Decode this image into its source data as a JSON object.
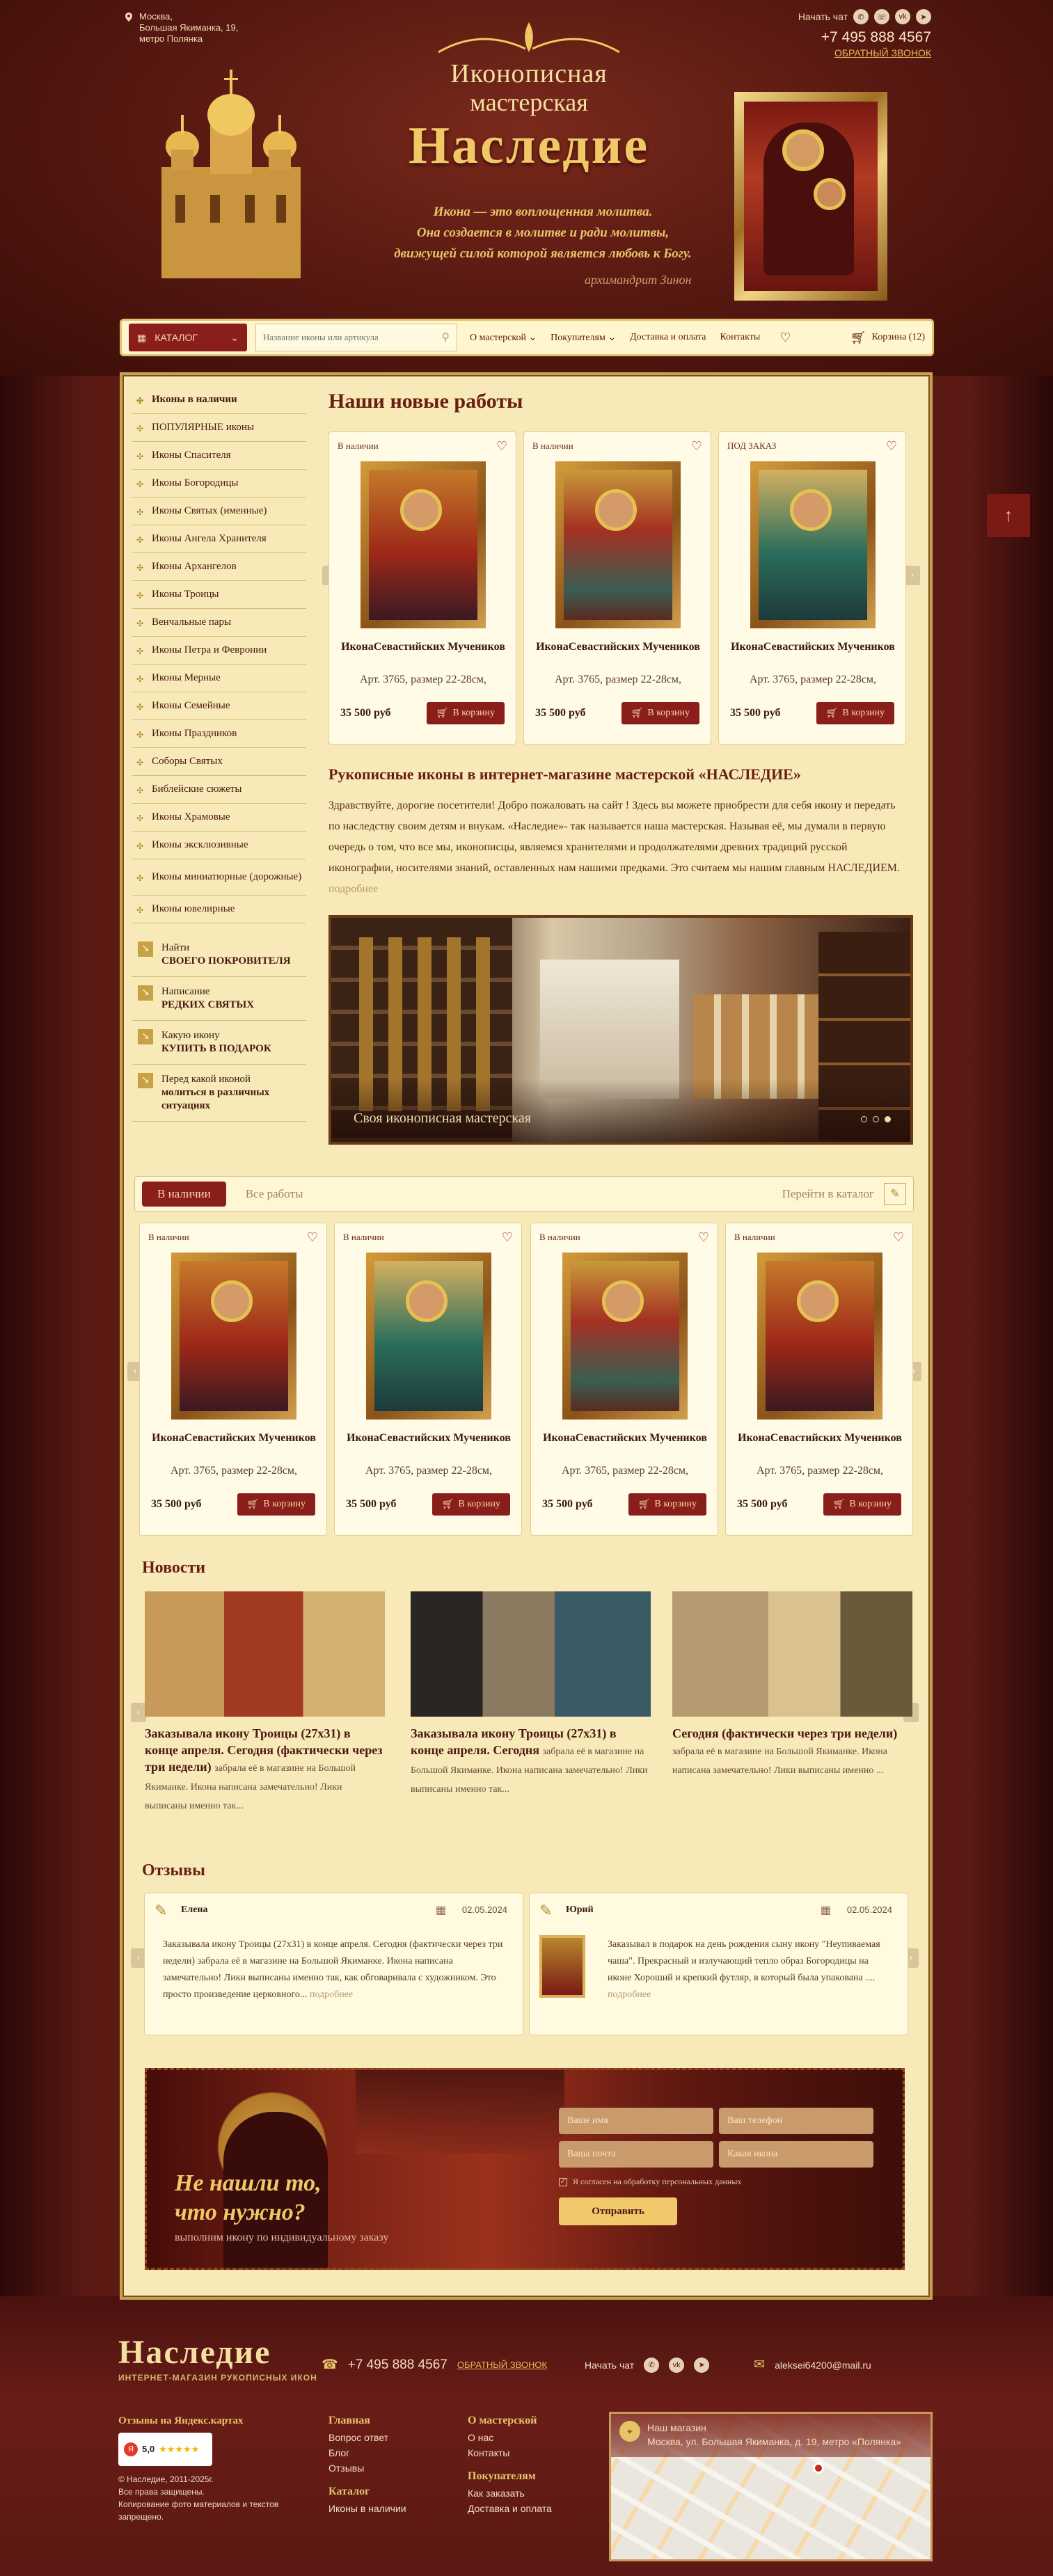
{
  "header": {
    "address_lines": [
      "Москва,",
      "Большая Якиманка, 19,",
      "метро Полянка"
    ],
    "logo_line1": "Иконописная",
    "logo_line2": "мастерская",
    "logo_line3": "Наследие",
    "quote_lines": [
      "Икона — это воплощенная молитва.",
      "Она создается в молитве и ради молитвы,",
      "движущей силой которой является любовь к Богу."
    ],
    "signature": "архимандрит Зинон",
    "chat_label": "Начать чат",
    "phone": "+7 495 888 4567",
    "callback": "ОБРАТНЫЙ ЗВОНОК"
  },
  "nav": {
    "catalog": "КАТАЛОГ",
    "search_placeholder": "Название иконы или артикула",
    "links": [
      "О мастерской",
      "Покупателям",
      "Доставка и оплата",
      "Контакты"
    ],
    "cart": "Корзина (12)"
  },
  "sidebar": {
    "items": [
      "Иконы в наличии",
      "ПОПУЛЯРНЫЕ иконы",
      "Иконы Спасителя",
      "Иконы Богородицы",
      "Иконы Святых (именные)",
      "Иконы Ангела Хранителя",
      "Иконы Архангелов",
      "Иконы Троицы",
      "Венчальные пары",
      "Иконы Петра и Февронии",
      "Иконы Мерные",
      "Иконы Семейные",
      "Иконы Праздников",
      "Соборы Святых",
      "Библейские сюжеты",
      "Иконы Храмовые",
      "Иконы эксклюзивные",
      "Иконы миниатюрные (дорожные)",
      "Иконы ювелирные"
    ],
    "extras": [
      {
        "top": "Найти",
        "bottom": "СВОЕГО ПОКРОВИТЕЛЯ"
      },
      {
        "top": "Написание",
        "bottom": "РЕДКИХ СВЯТЫХ"
      },
      {
        "top": "Какую икону",
        "bottom": "КУПИТЬ В ПОДАРОК"
      },
      {
        "top": "Перед какой иконой",
        "bottom": "молиться в различных ситуациях"
      }
    ]
  },
  "new_works": {
    "heading": "Наши новые работы",
    "cards": [
      {
        "status": "В наличии",
        "title": "ИконаСевастийских Мучеников",
        "art": "Арт. 3765, размер 22-28см,",
        "price": "35 500 руб",
        "buy": "В корзину"
      },
      {
        "status": "В наличии",
        "title": "ИконаСевастийских Мучеников",
        "art": "Арт. 3765, размер 22-28см,",
        "price": "35 500 руб",
        "buy": "В корзину"
      },
      {
        "status": "ПОД ЗАКАЗ",
        "title": "ИконаСевастийских Мучеников",
        "art": "Арт. 3765, размер 22-28см,",
        "price": "35 500 руб",
        "buy": "В корзину"
      }
    ]
  },
  "intro": {
    "heading": "Рукописные иконы в интернет-магазине мастерской «НАСЛЕДИЕ»",
    "text": "Здравствуйте, дорогие посетители! Добро пожаловать на сайт ! Здесь вы можете приобрести для себя икону и передать по наследству своим детям и внукам. «Наследие»- так называется наша мастерская. Называя её, мы думали в первую очередь о том, что все мы, иконописцы, являемся хранителями и продолжателями древних традиций русской иконографии, носителями знаний, оставленных нам нашими предками. Это считаем мы нашим главным НАСЛЕДИЕМ.",
    "more": "подробнее"
  },
  "banner": {
    "caption": "Своя иконописная мастерская"
  },
  "tabs": {
    "active": "В наличии",
    "inactive": "Все работы",
    "catalog_link": "Перейти в каталог"
  },
  "stock_cards": [
    {
      "status": "В наличии",
      "title": "ИконаСевастийских Мучеников",
      "art": "Арт. 3765, размер 22-28см,",
      "price": "35 500 руб",
      "buy": "В корзину"
    },
    {
      "status": "В наличии",
      "title": "ИконаСевастийских Мучеников",
      "art": "Арт. 3765, размер 22-28см,",
      "price": "35 500 руб",
      "buy": "В корзину"
    },
    {
      "status": "В наличии",
      "title": "ИконаСевастийских Мучеников",
      "art": "Арт. 3765, размер 22-28см,",
      "price": "35 500 руб",
      "buy": "В корзину"
    },
    {
      "status": "В наличии",
      "title": "ИконаСевастийских Мучеников",
      "art": "Арт. 3765, размер 22-28см,",
      "price": "35 500 руб",
      "buy": "В корзину"
    }
  ],
  "news": {
    "heading": "Новости",
    "items": [
      {
        "title": "Заказывала икону Троицы (27х31) в конце апреля. Сегодня (фактически через три недели)",
        "text": "забрала её в магазине на Большой Якиманке. Икона написана замечательно! Лики выписаны именно так..."
      },
      {
        "title": "Заказывала икону Троицы (27х31) в конце апреля. Сегодня",
        "text": "забрала её в магазине на Большой Якиманке. Икона написана замечательно! Лики выписаны именно так..."
      },
      {
        "title": "Сегодня (фактически через три недели)",
        "text": "забрала её в магазине на Большой Якиманке. Икона написана замечательно! Лики выписаны именно ..."
      }
    ]
  },
  "reviews": {
    "heading": "Отзывы",
    "items": [
      {
        "name": "Елена",
        "date": "02.05.2024",
        "text": "Заказывала икону Троицы (27х31) в конце апреля. Сегодня (фактически через три недели) забрала её в магазине на Большой Якиманке. Икона написана замечательно! Лики выписаны именно так, как обговаривала с художником. Это просто произведение церковного...",
        "more": "подробнее"
      },
      {
        "name": "Юрий",
        "date": "02.05.2024",
        "text": "Заказывал в подарок на день рождения сыну икону \"Неупиваемая чаша\". Прекрасный и излучающий тепло образ Богородицы на иконе Хороший и крепкий футляр, в который была упакована ....",
        "more": "подробнее"
      }
    ]
  },
  "cta": {
    "heading_line1": "Не нашли то,",
    "heading_line2": "что нужно?",
    "sub": "выполним икону по индивидуальному заказу",
    "name_ph": "Ваше имя",
    "phone_ph": "Ваш телефон",
    "mail_ph": "Ваша почта",
    "icon_ph": "Какая икона",
    "consent": "Я согласен на обработку персональных данных",
    "submit": "Отправить"
  },
  "footer": {
    "logo": "Наследие",
    "logo_sub": "ИНТЕРНЕТ-МАГАЗИН РУКОПИСНЫХ ИКОН",
    "phone": "+7 495 888 4567",
    "callback": "ОБРАТНЫЙ ЗВОНОК",
    "chat_label": "Начать чат",
    "email": "aleksei64200@mail.ru",
    "yandex": "Отзывы на Яндекс.картах",
    "rating": "5,0",
    "copyright": [
      "© Наследие, 2011-2025г.",
      "Все права защищены.",
      "Копирование фото материалов и текстов запрещено."
    ],
    "col_main": {
      "title": "Главная",
      "links": [
        "Вопрос ответ",
        "Блог",
        "Отзывы"
      ]
    },
    "col_catalog": {
      "title": "Каталог",
      "links": [
        "Иконы в наличии"
      ]
    },
    "col_about": {
      "title": "О мастерской",
      "links": [
        "О нас",
        "Контакты"
      ]
    },
    "col_buyers": {
      "title": "Покупателям",
      "links": [
        "Как заказать",
        "Доставка и оплата"
      ]
    },
    "map_title": "Наш магазин",
    "map_address": "Москва, ул. Большая Якиманка, д. 19, метро «Полянка»"
  },
  "colors": {
    "accent": "#8a1e1a",
    "gold": "#e6c46a",
    "page_bg": "#f7eab8"
  }
}
